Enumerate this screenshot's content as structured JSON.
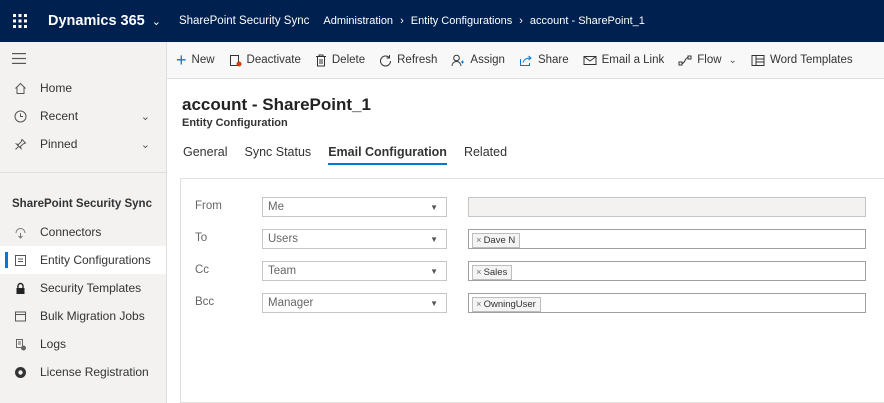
{
  "topbar": {
    "app_name": "Dynamics 365",
    "app_module": "SharePoint Security Sync",
    "breadcrumb": [
      "Administration",
      "Entity Configurations",
      "account - SharePoint_1"
    ]
  },
  "sidebar": {
    "top_items": [
      {
        "label": "Home",
        "icon": "home-icon"
      },
      {
        "label": "Recent",
        "icon": "clock-icon"
      },
      {
        "label": "Pinned",
        "icon": "pin-icon"
      }
    ],
    "group_title": "SharePoint Security Sync",
    "group_items": [
      {
        "label": "Connectors",
        "icon": "connector-icon"
      },
      {
        "label": "Entity Configurations",
        "icon": "config-icon",
        "selected": true
      },
      {
        "label": "Security Templates",
        "icon": "lock-icon"
      },
      {
        "label": "Bulk Migration Jobs",
        "icon": "window-icon"
      },
      {
        "label": "Logs",
        "icon": "log-icon"
      },
      {
        "label": "License Registration",
        "icon": "badge-icon"
      }
    ]
  },
  "commands": {
    "new": "New",
    "deactivate": "Deactivate",
    "delete": "Delete",
    "refresh": "Refresh",
    "assign": "Assign",
    "share": "Share",
    "email_link": "Email a Link",
    "flow": "Flow",
    "word_templates": "Word Templates"
  },
  "record": {
    "title": "account - SharePoint_1",
    "subtitle": "Entity Configuration"
  },
  "tabs": {
    "general": "General",
    "sync_status": "Sync Status",
    "email_config": "Email Configuration",
    "related": "Related"
  },
  "email_form": {
    "from": {
      "label": "From",
      "value": "Me",
      "tag": ""
    },
    "to": {
      "label": "To",
      "value": "Users",
      "tag": "Dave N"
    },
    "cc": {
      "label": "Cc",
      "value": "Team",
      "tag": "Sales"
    },
    "bcc": {
      "label": "Bcc",
      "value": "Manager",
      "tag": "OwningUser"
    }
  },
  "colors": {
    "topbar": "#002050",
    "accent": "#0078d4",
    "sidebar_bg": "#f3f2f1"
  }
}
